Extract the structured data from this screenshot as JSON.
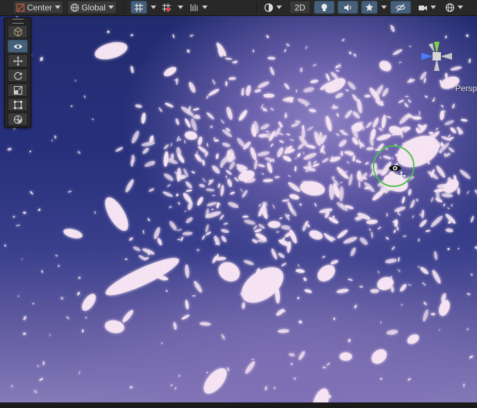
{
  "toolbar": {
    "pivot_mode": {
      "label": "Center",
      "icon": "pivot-center-icon"
    },
    "pivot_rotation": {
      "label": "Global",
      "icon": "global-icon"
    },
    "grid_snap_icon": "grid-snap-icon",
    "increment_snap_icon": "increment-snap-icon",
    "snap_settings_icon": "snap-settings-icon",
    "draw_mode_icon": "draw-mode-icon",
    "mode_2d_label": "2D",
    "lighting_icon": "light-bulb-icon",
    "audio_icon": "audio-icon",
    "effects_icon": "effects-icon",
    "hidden_objects_icon": "hidden-eye-icon",
    "camera_icon": "scene-camera-icon",
    "gizmos_icon": "gizmos-globe-icon"
  },
  "tools": [
    {
      "name": "view-tool",
      "icon": "eye-icon",
      "active": true
    },
    {
      "name": "move-tool",
      "icon": "move-arrows-icon",
      "active": false
    },
    {
      "name": "rotate-tool",
      "icon": "rotate-icon",
      "active": false
    },
    {
      "name": "scale-tool",
      "icon": "scale-icon",
      "active": false
    },
    {
      "name": "rect-tool",
      "icon": "rect-icon",
      "active": false
    },
    {
      "name": "transform-tool",
      "icon": "transform-icon",
      "active": false
    }
  ],
  "gizmo": {
    "projection_label": "Persp"
  },
  "scene": {
    "background_top": "#222c70",
    "background_bottom": "#857bb8",
    "petal_color": "#f6e4f2",
    "camera_ring_color": "#4cc24c"
  }
}
